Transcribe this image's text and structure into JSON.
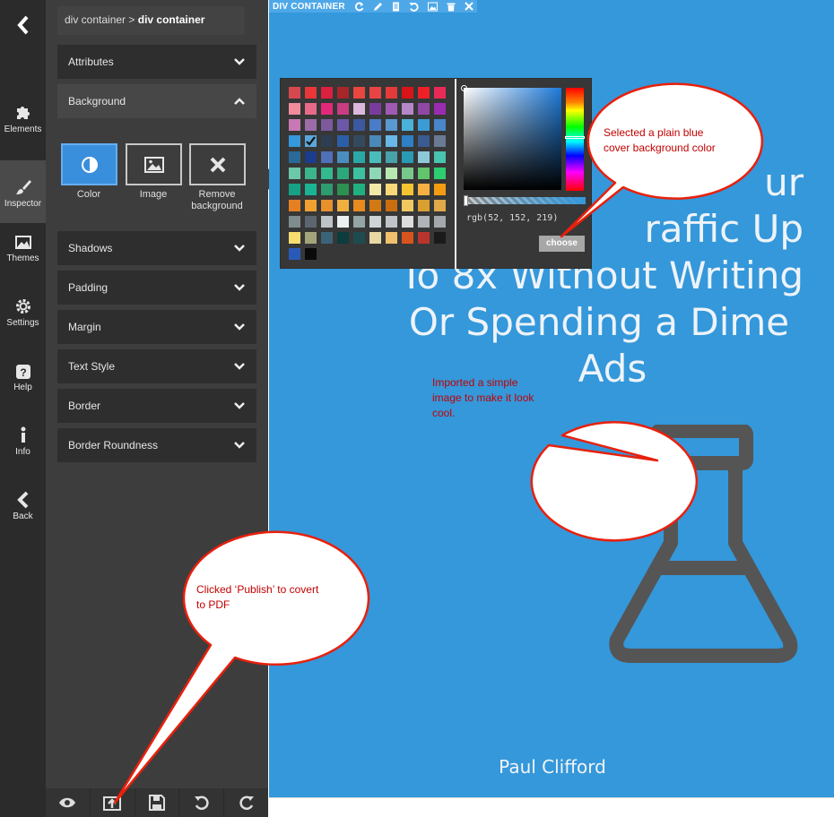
{
  "rail": {
    "items": [
      {
        "label": "Elements"
      },
      {
        "label": "Inspector"
      },
      {
        "label": "Themes"
      },
      {
        "label": "Settings"
      },
      {
        "label": "Help"
      },
      {
        "label": "Info"
      },
      {
        "label": "Back"
      }
    ],
    "active": "Inspector"
  },
  "breadcrumb": {
    "first": "div container",
    "separator": ">",
    "current": "div container"
  },
  "sections": {
    "attributes": "Attributes",
    "background": "Background",
    "shadows": "Shadows",
    "padding": "Padding",
    "margin": "Margin",
    "text_style": "Text Style",
    "border": "Border",
    "border_roundness": "Border Roundness"
  },
  "background_options": {
    "color": "Color",
    "image": "Image",
    "remove": "Remove background"
  },
  "canvas": {
    "element_label": "DIV CONTAINER",
    "headline_lines": [
      "ur",
      "raffic Up",
      "To 8x Without Writing",
      "Or Spending a Dime",
      "Ads"
    ],
    "author": "Paul Clifford",
    "background_color": "#3498db"
  },
  "color_picker": {
    "rgb_value": "rgb(52, 152, 219)",
    "choose_label": "choose",
    "selected_color": "#3498db"
  },
  "callouts": {
    "color": "Selected a plain blue cover background color",
    "image": "Imported a simple image to make it look cool.",
    "publish": "Clicked ‘Publish’ to covert to PDF"
  },
  "colors": {
    "accent": "#3a8fdc",
    "callout_fill": "#ffffff",
    "callout_stroke": "#e8200c"
  }
}
